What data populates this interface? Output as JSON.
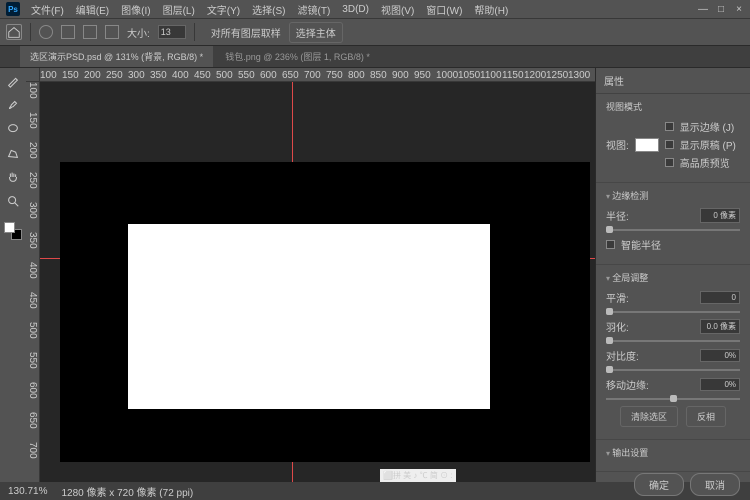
{
  "app": {
    "logo": "Ps"
  },
  "menu": [
    "文件(F)",
    "编辑(E)",
    "图像(I)",
    "图层(L)",
    "文字(Y)",
    "选择(S)",
    "滤镜(T)",
    "3D(D)",
    "视图(V)",
    "窗口(W)",
    "帮助(H)"
  ],
  "window_controls": {
    "min": "—",
    "max": "□",
    "close": "×"
  },
  "optionbar": {
    "size_label": "大小:",
    "size_value": "13",
    "btn1": "对所有图层取样",
    "btn2": "选择主体"
  },
  "tabs": [
    {
      "label": "选区演示PSD.psd @ 131% (背景, RGB/8) *",
      "active": true
    },
    {
      "label": "钱包.png @ 236% (图层 1, RGB/8) *",
      "active": false
    }
  ],
  "ruler_h": [
    "100",
    "150",
    "200",
    "250",
    "300",
    "350",
    "400",
    "450",
    "500",
    "550",
    "600",
    "650",
    "700",
    "750",
    "800",
    "850",
    "900",
    "950",
    "1000",
    "1050",
    "1100",
    "1150",
    "1200",
    "1250",
    "1300"
  ],
  "ruler_v": [
    "100",
    "150",
    "200",
    "250",
    "300",
    "350",
    "400",
    "450",
    "500",
    "550",
    "600",
    "650",
    "700"
  ],
  "panel": {
    "title": "属性",
    "viewmode": {
      "title": "视图模式",
      "btn_label": "视图:",
      "opts": [
        "显示边缘 (J)",
        "显示原稿 (P)",
        "高品质预览"
      ]
    },
    "edge": {
      "title": "边缘检测",
      "radius_label": "半径:",
      "radius_value": "0 像素",
      "smart": "智能半径"
    },
    "global": {
      "title": "全局调整",
      "smooth_label": "平滑:",
      "smooth_value": "0",
      "feather_label": "羽化:",
      "feather_value": "0.0 像素",
      "contrast_label": "对比度:",
      "contrast_value": "0%",
      "shift_label": "移动边缘:",
      "shift_value": "0%",
      "clear": "清除选区",
      "invert": "反相"
    },
    "output": {
      "title": "输出设置"
    }
  },
  "status": {
    "zoom": "130.71%",
    "dims": "1280 像素 x 720 像素 (72 ppi)"
  },
  "footer": {
    "ok": "确定",
    "cancel": "取消"
  },
  "tasktray": "⬜拼 美 ♪ ℃ 简 ⊙ :"
}
